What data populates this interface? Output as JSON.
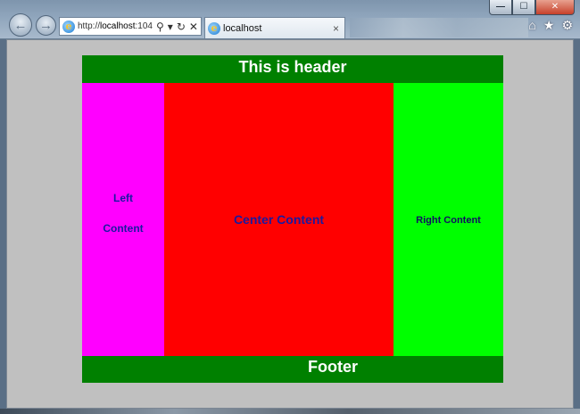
{
  "browser": {
    "address_prefix": "http://",
    "address_host": "localhost",
    "address_suffix": ":104",
    "tab_title": "localhost",
    "tab_close": "×",
    "win_min": "—",
    "win_max": "☐",
    "win_close": "✕",
    "back_glyph": "←",
    "forward_glyph": "→",
    "search_glyph": "⚲",
    "dropdown_glyph": "▾",
    "refresh_glyph": "↻",
    "stop_glyph": "✕",
    "home_glyph": "⌂",
    "favorites_glyph": "★",
    "tools_glyph": "⚙"
  },
  "page": {
    "header": "This is header",
    "left_line1": "Left",
    "left_line2": "Content",
    "center": "Center Content",
    "right": "Right Content",
    "footer": "Footer"
  },
  "colors": {
    "header_footer": "#008000",
    "left": "#ff00ff",
    "center": "#ff0000",
    "right": "#00ff00",
    "page_background": "#c0c0c0"
  }
}
